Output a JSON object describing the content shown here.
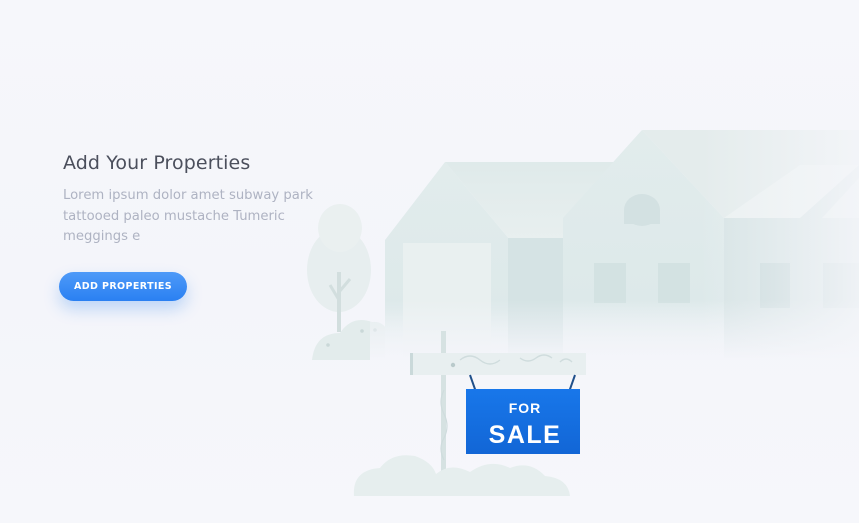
{
  "hero": {
    "title": "Add Your Properties",
    "description": "Lorem ipsum dolor amet subway park tattooed paleo mustache Tumeric  meggings e",
    "cta_label": "ADD PROPERTIES"
  },
  "sign": {
    "line1": "FOR",
    "line2": "SALE"
  },
  "colors": {
    "accent": "#2a80f2",
    "sign_blue": "#1570e0",
    "title": "#4b4f5c",
    "body_text": "#aeb3c2",
    "house": "#dde9ea"
  }
}
